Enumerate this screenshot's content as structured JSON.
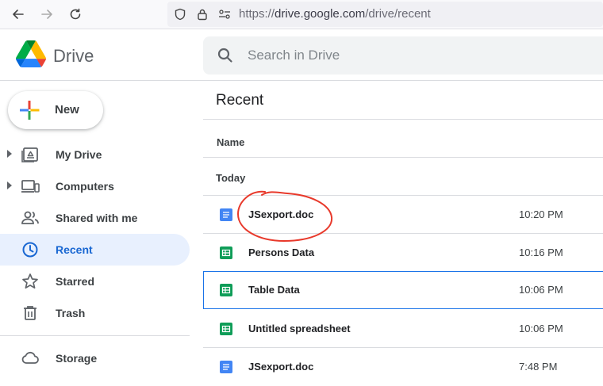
{
  "browser": {
    "url_protocol": "https://",
    "url_host": "drive.google.com",
    "url_path": "/drive/recent"
  },
  "header": {
    "app_name": "Drive",
    "search_placeholder": "Search in Drive"
  },
  "sidebar": {
    "new_label": "New",
    "items": [
      {
        "label": "My Drive",
        "icon": "my-drive-icon",
        "expandable": true,
        "active": false
      },
      {
        "label": "Computers",
        "icon": "computers-icon",
        "expandable": true,
        "active": false
      },
      {
        "label": "Shared with me",
        "icon": "shared-icon",
        "expandable": false,
        "active": false
      },
      {
        "label": "Recent",
        "icon": "clock-icon",
        "expandable": false,
        "active": true
      },
      {
        "label": "Starred",
        "icon": "star-icon",
        "expandable": false,
        "active": false
      },
      {
        "label": "Trash",
        "icon": "trash-icon",
        "expandable": false,
        "active": false
      }
    ],
    "storage_label": "Storage"
  },
  "main": {
    "title": "Recent",
    "column_name": "Name",
    "group_label": "Today",
    "files": [
      {
        "name": "JSexport.doc",
        "time": "10:20 PM",
        "type": "doc",
        "selected": false
      },
      {
        "name": "Persons Data",
        "time": "10:16 PM",
        "type": "sheet",
        "selected": false
      },
      {
        "name": "Table Data",
        "time": "10:06 PM",
        "type": "sheet",
        "selected": true
      },
      {
        "name": "Untitled spreadsheet",
        "time": "10:06 PM",
        "type": "sheet",
        "selected": false
      },
      {
        "name": "JSexport.doc",
        "time": "7:48 PM",
        "type": "doc",
        "selected": false
      }
    ]
  },
  "colors": {
    "doc_blue": "#4285f4",
    "sheet_green": "#0f9d58",
    "active_bg": "#e8f0fe",
    "active_text": "#1967d2",
    "annotation_red": "#e8392b"
  }
}
